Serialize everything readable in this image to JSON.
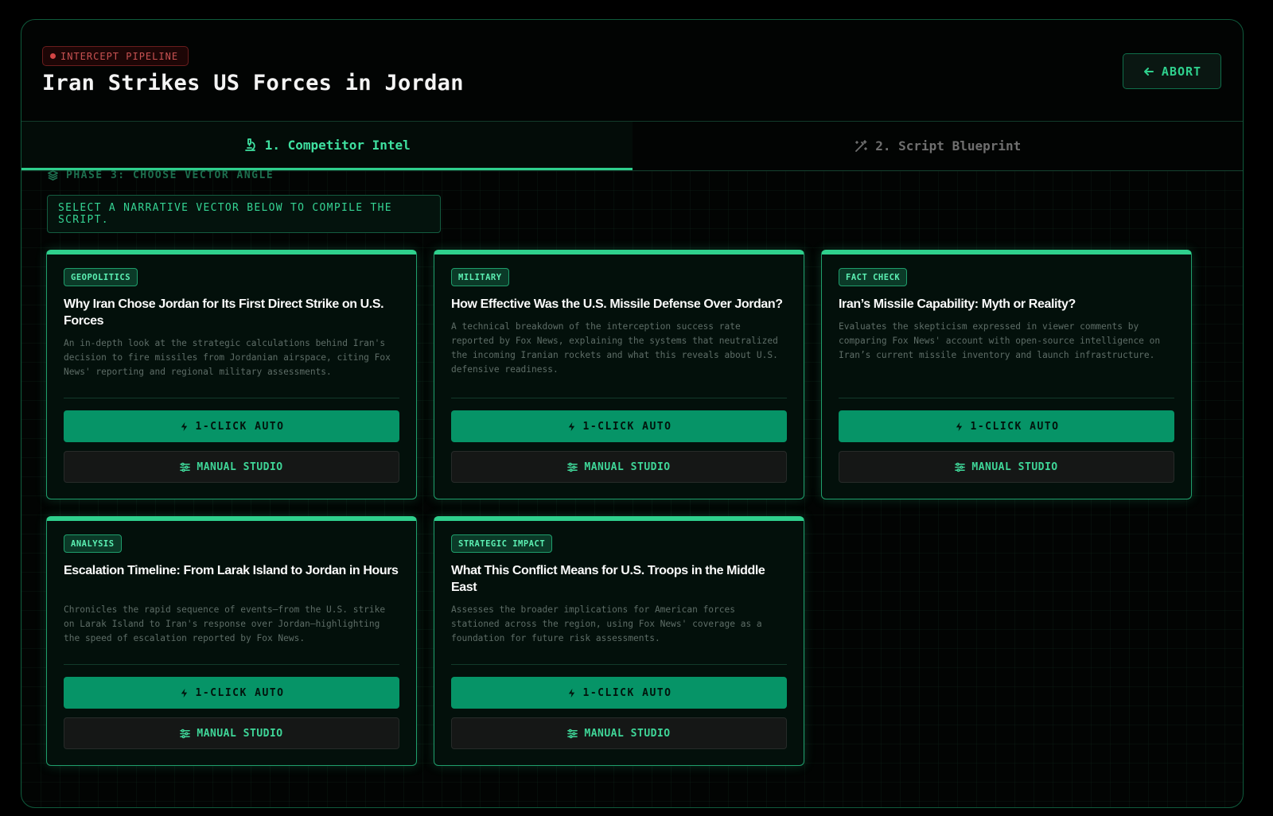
{
  "header": {
    "badge": "INTERCEPT PIPELINE",
    "title": "Iran Strikes US Forces in Jordan",
    "abort_label": "ABORT"
  },
  "tabs": [
    {
      "label": "1. Competitor Intel",
      "active": true,
      "icon": "microscope-icon"
    },
    {
      "label": "2. Script Blueprint",
      "active": false,
      "icon": "magic-wand-icon"
    }
  ],
  "phase": {
    "label": "PHASE 3: CHOOSE VECTOR ANGLE",
    "instruction": "SELECT A NARRATIVE VECTOR BELOW TO COMPILE THE SCRIPT."
  },
  "cards": [
    {
      "tag": "GEOPOLITICS",
      "title": "Why Iran Chose Jordan for Its First Direct Strike on U.S. Forces",
      "description": "An in-depth look at the strategic calculations behind Iran's decision to fire missiles from Jordanian airspace, citing Fox News' reporting and regional military assessments.",
      "auto_label": "1-CLICK AUTO",
      "manual_label": "MANUAL STUDIO"
    },
    {
      "tag": "MILITARY",
      "title": "How Effective Was the U.S. Missile Defense Over Jordan?",
      "description": "A technical breakdown of the interception success rate reported by Fox News, explaining the systems that neutralized the incoming Iranian rockets and what this reveals about U.S. defensive readiness.",
      "auto_label": "1-CLICK AUTO",
      "manual_label": "MANUAL STUDIO"
    },
    {
      "tag": "FACT CHECK",
      "title": "Iran’s Missile Capability: Myth or Reality?",
      "description": "Evaluates the skepticism expressed in viewer comments by comparing Fox News' account with open-source intelligence on Iran’s current missile inventory and launch infrastructure.",
      "auto_label": "1-CLICK AUTO",
      "manual_label": "MANUAL STUDIO"
    },
    {
      "tag": "ANALYSIS",
      "title": "Escalation Timeline: From Larak Island to Jordan in Hours",
      "description": "Chronicles the rapid sequence of events—from the U.S. strike on Larak Island to Iran's response over Jordan—highlighting the speed of escalation reported by Fox News.",
      "auto_label": "1-CLICK AUTO",
      "manual_label": "MANUAL STUDIO"
    },
    {
      "tag": "STRATEGIC IMPACT",
      "title": "What This Conflict Means for U.S. Troops in the Middle East",
      "description": "Assesses the broader implications for American forces stationed across the region, using Fox News' coverage as a foundation for future risk assessments.",
      "auto_label": "1-CLICK AUTO",
      "manual_label": "MANUAL STUDIO"
    }
  ],
  "colors": {
    "accent": "#2fd08d",
    "button_green": "#069467",
    "danger": "#d64545"
  }
}
